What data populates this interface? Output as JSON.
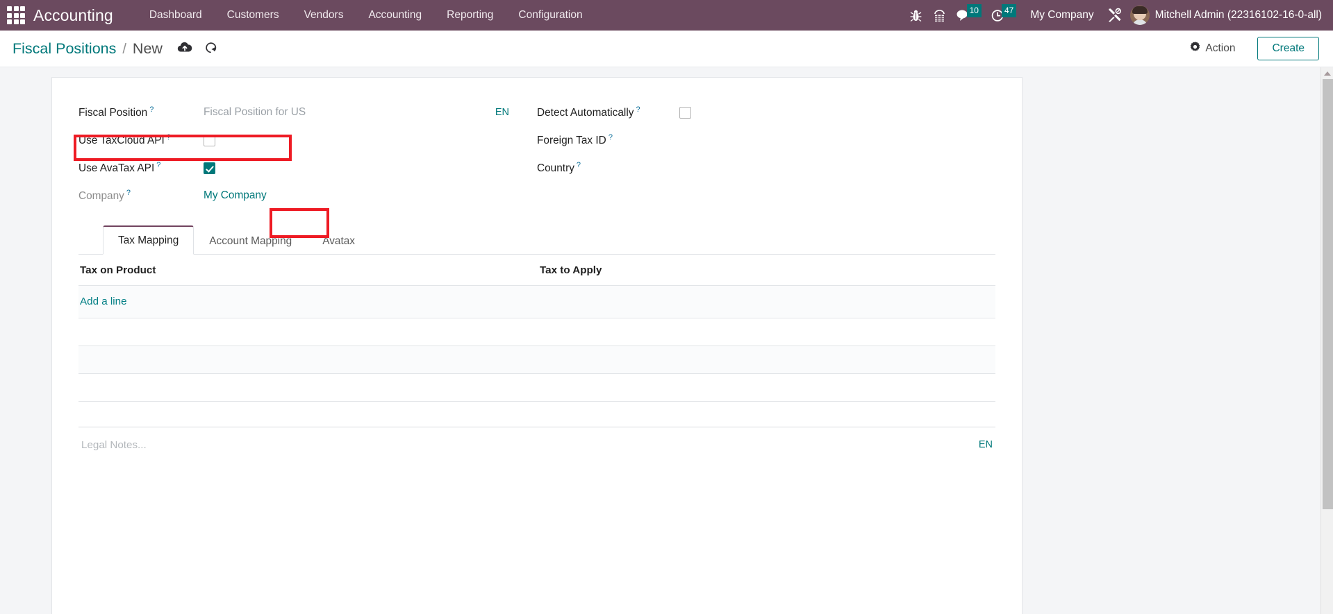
{
  "navbar": {
    "apps_icon": "apps-grid-icon",
    "brand": "Accounting",
    "menu": [
      {
        "label": "Dashboard"
      },
      {
        "label": "Customers"
      },
      {
        "label": "Vendors"
      },
      {
        "label": "Accounting"
      },
      {
        "label": "Reporting"
      },
      {
        "label": "Configuration"
      }
    ],
    "sys_icons": [
      {
        "name": "bug-icon"
      },
      {
        "name": "pad-icon"
      }
    ],
    "messages": {
      "icon": "message-bubble-icon",
      "count": "10"
    },
    "activities": {
      "icon": "clock-icon",
      "count": "47"
    },
    "company": "My Company",
    "tools_icon": "tools-icon",
    "user": {
      "avatar": "user-avatar",
      "name": "Mitchell Admin (22316102-16-0-all)"
    },
    "colors": {
      "background": "#6B4A5F",
      "badge": "#00787a"
    }
  },
  "control_panel": {
    "breadcrumb_root": "Fiscal Positions",
    "breadcrumb_sep": "/",
    "breadcrumb_current": "New",
    "save_icon": "cloud-upload-icon",
    "discard_icon": "undo-icon",
    "action_label": "Action",
    "action_icon": "gear-icon",
    "create_label": "Create",
    "accent": "#00787a"
  },
  "form": {
    "left": [
      {
        "label": "Fiscal Position",
        "help": "?",
        "type": "text",
        "value": "Fiscal Position for US",
        "is_placeholder": true,
        "lang": "EN"
      },
      {
        "label": "Use TaxCloud API",
        "help": "?",
        "type": "checkbox",
        "checked": false
      },
      {
        "label": "Use AvaTax API",
        "help": "?",
        "type": "checkbox",
        "checked": true,
        "highlighted": true
      },
      {
        "label": "Company",
        "help": "?",
        "type": "link",
        "value": "My Company",
        "muted_label": true
      }
    ],
    "right": [
      {
        "label": "Detect Automatically",
        "help": "?",
        "type": "checkbox",
        "checked": false
      },
      {
        "label": "Foreign Tax ID",
        "help": "?",
        "type": "text",
        "value": ""
      },
      {
        "label": "Country",
        "help": "?",
        "type": "text",
        "value": ""
      }
    ]
  },
  "tabs": [
    {
      "label": "Tax Mapping",
      "active": true
    },
    {
      "label": "Account Mapping",
      "active": false
    },
    {
      "label": "Avatax",
      "active": false,
      "highlighted": true
    }
  ],
  "table": {
    "columns": [
      "Tax on Product",
      "Tax to Apply"
    ],
    "rows": [],
    "add_line_label": "Add a line"
  },
  "notes": {
    "placeholder": "Legal Notes...",
    "lang": "EN"
  },
  "scrollbar": {
    "up_arrow_icon": "scroll-up-arrow-icon"
  },
  "annotations": [
    {
      "name": "highlight-use-avatax-api-row",
      "color": "#ee1b24"
    },
    {
      "name": "highlight-avatax-tab",
      "color": "#ee1b24"
    }
  ]
}
